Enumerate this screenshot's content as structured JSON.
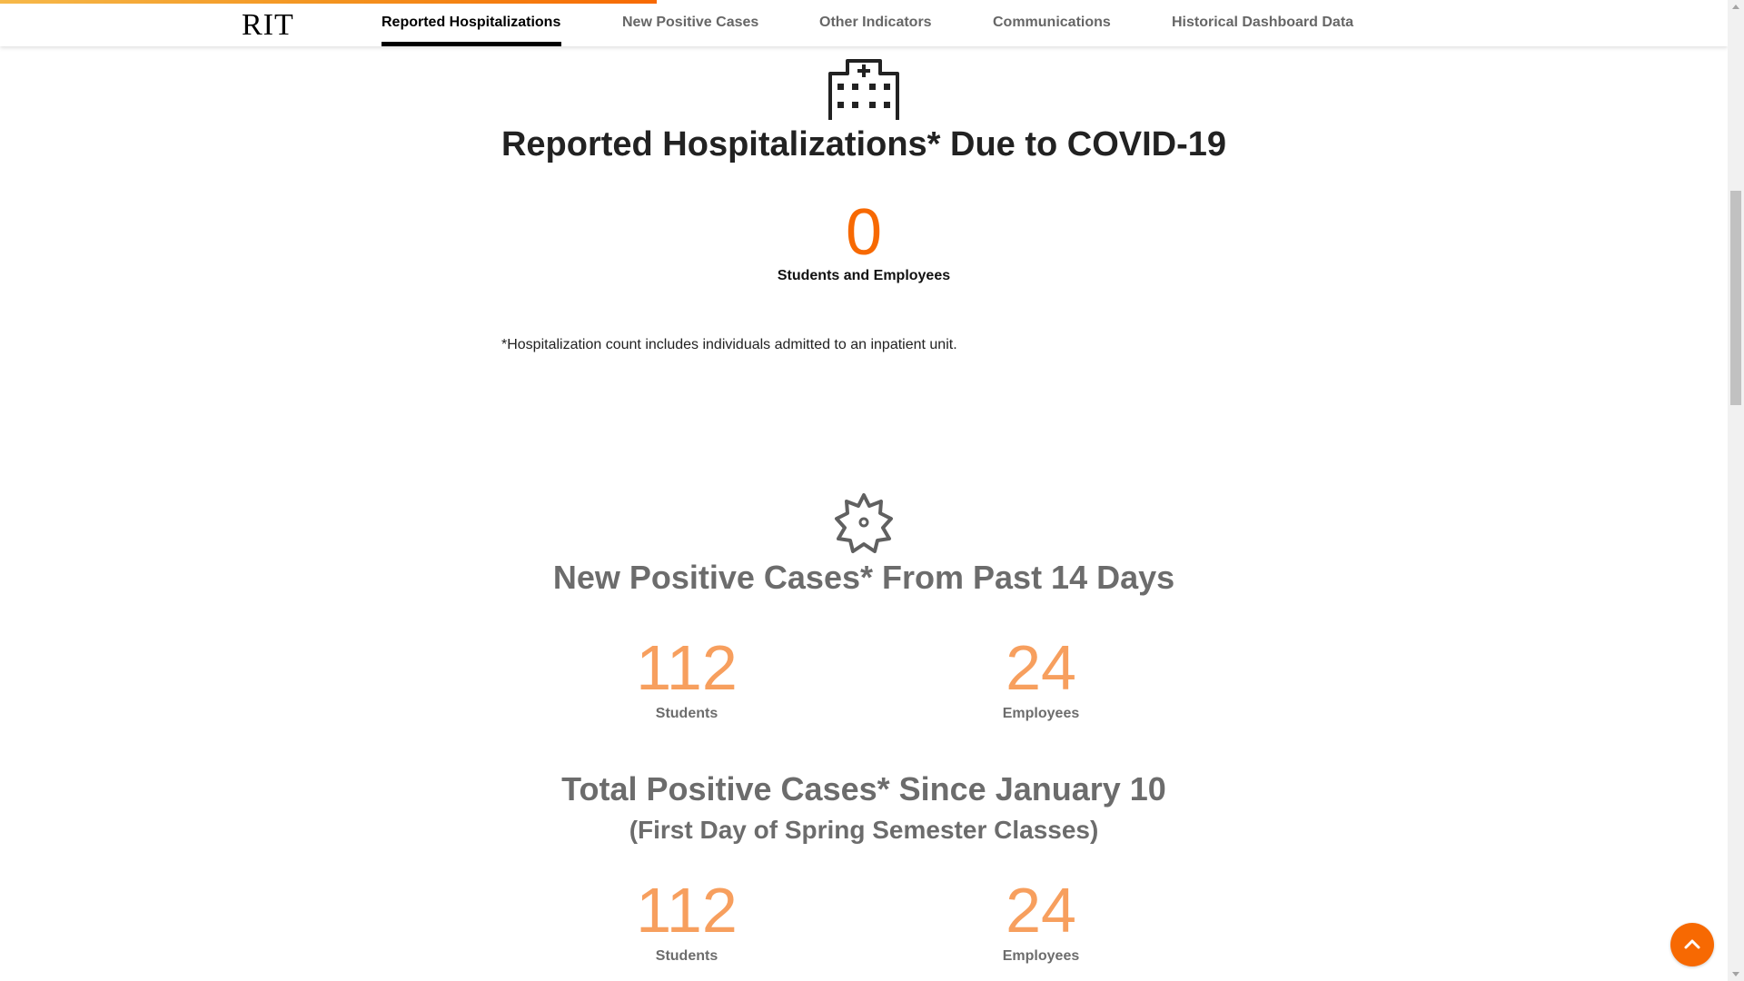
{
  "nav": {
    "logo": "RIT",
    "links": [
      {
        "label": "Reported Hospitalizations",
        "active": true
      },
      {
        "label": "New Positive Cases",
        "active": false
      },
      {
        "label": "Other Indicators",
        "active": false
      },
      {
        "label": "Communications",
        "active": false
      },
      {
        "label": "Historical Dashboard Data",
        "active": false
      }
    ],
    "progress_fraction": 0.38
  },
  "hospitalizations": {
    "icon": "hospital-icon",
    "title": "Reported Hospitalizations* Due to COVID-19",
    "count": "0",
    "count_label": "Students and Employees",
    "footnote": "*Hospitalization count includes individuals admitted to an inpatient unit."
  },
  "new_cases": {
    "icon": "virus-icon",
    "title": "New Positive Cases* From Past 14 Days",
    "students": "112",
    "students_label": "Students",
    "employees": "24",
    "employees_label": "Employees"
  },
  "total_cases": {
    "title": "Total Positive Cases* Since January 10",
    "subtitle": "(First Day of Spring Semester Classes)",
    "students": "112",
    "students_label": "Students",
    "employees": "24",
    "employees_label": "Employees"
  },
  "colors": {
    "accent": "#f76902",
    "number_orange": "#f47a1f",
    "progress_start": "#f6b94a"
  },
  "back_to_top": {
    "icon": "chevron-up-icon"
  }
}
